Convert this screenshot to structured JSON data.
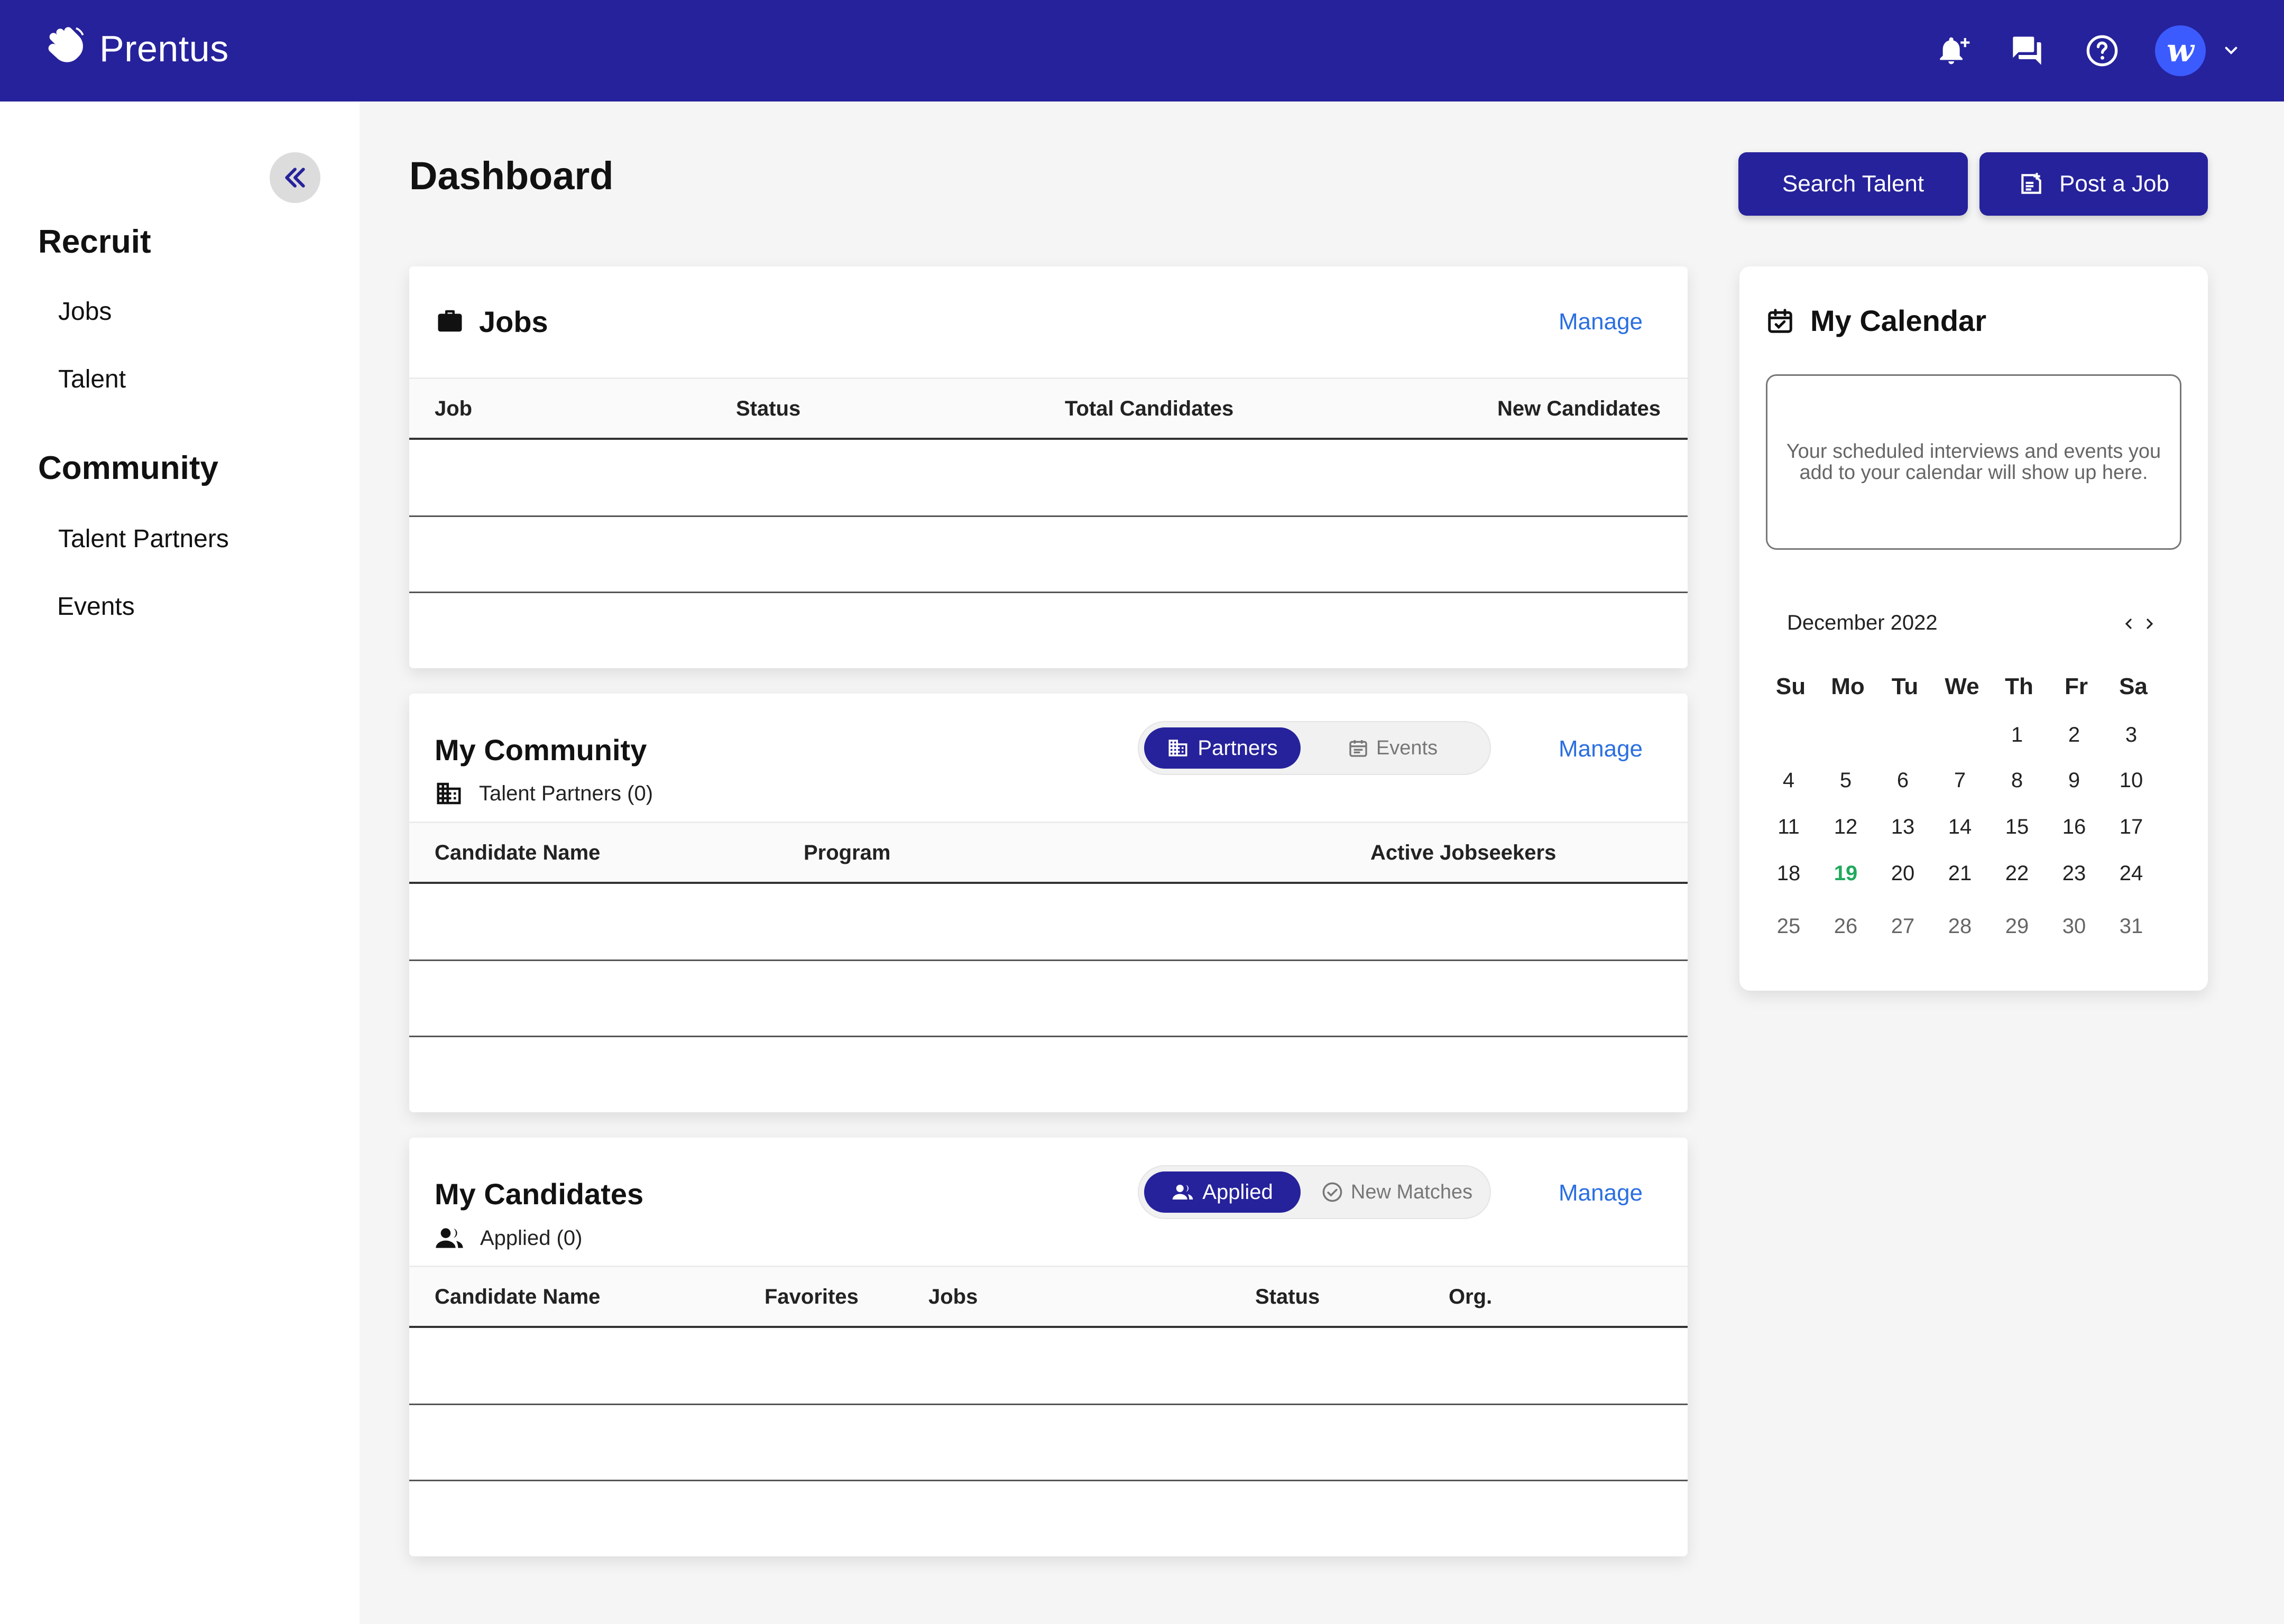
{
  "app": {
    "brand": "Prentus",
    "avatar_letter": "w"
  },
  "topbar": {
    "icons": [
      "bell-plus-icon",
      "chat-icon",
      "help-icon",
      "chevron-down-icon"
    ]
  },
  "sidebar": {
    "sections": [
      {
        "title": "Recruit",
        "items": [
          "Jobs",
          "Talent"
        ]
      },
      {
        "title": "Community",
        "items": [
          "Talent Partners",
          "Events"
        ]
      }
    ]
  },
  "page": {
    "title": "Dashboard",
    "search_talent": "Search Talent",
    "post_job": "Post a Job"
  },
  "jobs_card": {
    "title": "Jobs",
    "manage": "Manage",
    "columns": [
      "Job",
      "Status",
      "Total Candidates",
      "New Candidates"
    ]
  },
  "community_card": {
    "title": "My Community",
    "manage": "Manage",
    "subtitle": "Talent Partners (0)",
    "toggle_active": "Partners",
    "toggle_inactive": "Events",
    "columns": [
      "Candidate Name",
      "Program",
      "Active Jobseekers"
    ]
  },
  "candidates_card": {
    "title": "My Candidates",
    "manage": "Manage",
    "subtitle": "Applied (0)",
    "toggle_active": "Applied",
    "toggle_inactive": "New Matches",
    "columns": [
      "Candidate Name",
      "Favorites",
      "Jobs",
      "Status",
      "Org."
    ]
  },
  "calendar": {
    "title": "My Calendar",
    "empty_message": "Your scheduled interviews and events you add to your calendar will show up here.",
    "month_label": "December 2022",
    "weekdays": [
      "Su",
      "Mo",
      "Tu",
      "We",
      "Th",
      "Fr",
      "Sa"
    ],
    "weeks": [
      [
        "",
        "",
        "",
        "",
        "1",
        "2",
        "3"
      ],
      [
        "4",
        "5",
        "6",
        "7",
        "8",
        "9",
        "10"
      ],
      [
        "11",
        "12",
        "13",
        "14",
        "15",
        "16",
        "17"
      ],
      [
        "18",
        "19",
        "20",
        "21",
        "22",
        "23",
        "24"
      ],
      [
        "25",
        "26",
        "27",
        "28",
        "29",
        "30",
        "31"
      ]
    ],
    "today": "19"
  },
  "colors": {
    "primary": "#26229b",
    "link": "#2b6fe0",
    "today": "#1faa5c",
    "avatar": "#3b5bff"
  }
}
